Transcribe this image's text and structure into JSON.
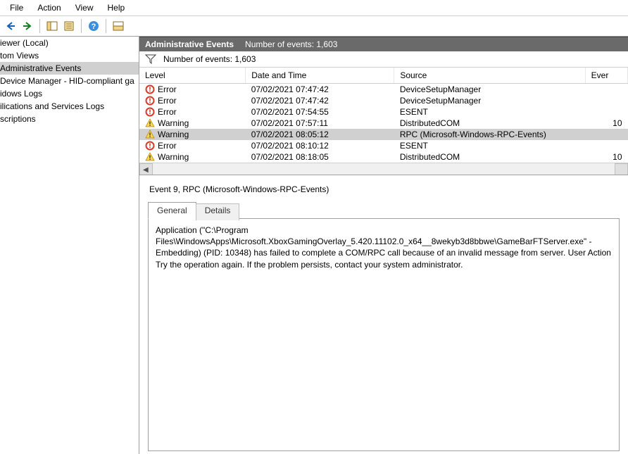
{
  "menu": {
    "items": [
      "File",
      "Action",
      "View",
      "Help"
    ]
  },
  "toolbar": {
    "back": "back-icon",
    "forward": "forward-icon",
    "up": "up-icon",
    "properties": "properties-icon",
    "help": "help-icon",
    "pane": "pane-icon"
  },
  "tree": {
    "items": [
      {
        "label": "iewer (Local)",
        "selected": false
      },
      {
        "label": "tom Views",
        "selected": false
      },
      {
        "label": "Administrative Events",
        "selected": true
      },
      {
        "label": "Device Manager - HID-compliant ga",
        "selected": false
      },
      {
        "label": "idows Logs",
        "selected": false
      },
      {
        "label": "ilications and Services Logs",
        "selected": false
      },
      {
        "label": "scriptions",
        "selected": false
      }
    ]
  },
  "header": {
    "title": "Administrative Events",
    "count_label": "Number of events: 1,603"
  },
  "filter": {
    "count_label": "Number of events: 1,603"
  },
  "columns": {
    "level": "Level",
    "date": "Date and Time",
    "source": "Source",
    "eventid": "Ever"
  },
  "events": [
    {
      "level": "Error",
      "icon": "error",
      "date": "07/02/2021 07:47:42",
      "source": "DeviceSetupManager",
      "eventid": "",
      "selected": false
    },
    {
      "level": "Error",
      "icon": "error",
      "date": "07/02/2021 07:47:42",
      "source": "DeviceSetupManager",
      "eventid": "",
      "selected": false
    },
    {
      "level": "Error",
      "icon": "error",
      "date": "07/02/2021 07:54:55",
      "source": "ESENT",
      "eventid": "",
      "selected": false
    },
    {
      "level": "Warning",
      "icon": "warning",
      "date": "07/02/2021 07:57:11",
      "source": "DistributedCOM",
      "eventid": "10",
      "selected": false
    },
    {
      "level": "Warning",
      "icon": "warning",
      "date": "07/02/2021 08:05:12",
      "source": "RPC (Microsoft-Windows-RPC-Events)",
      "eventid": "",
      "selected": true
    },
    {
      "level": "Error",
      "icon": "error",
      "date": "07/02/2021 08:10:12",
      "source": "ESENT",
      "eventid": "",
      "selected": false
    },
    {
      "level": "Warning",
      "icon": "warning",
      "date": "07/02/2021 08:18:05",
      "source": "DistributedCOM",
      "eventid": "10",
      "selected": false
    }
  ],
  "detail": {
    "title": "Event 9, RPC (Microsoft-Windows-RPC-Events)",
    "tabs": {
      "general": "General",
      "details": "Details"
    },
    "body": "Application (\"C:\\Program Files\\WindowsApps\\Microsoft.XboxGamingOverlay_5.420.11102.0_x64__8wekyb3d8bbwe\\GameBarFTServer.exe\" -Embedding) (PID: 10348) has failed to complete a COM/RPC call because of an invalid message from server.  User Action Try the operation again. If the problem persists, contact your system administrator."
  }
}
